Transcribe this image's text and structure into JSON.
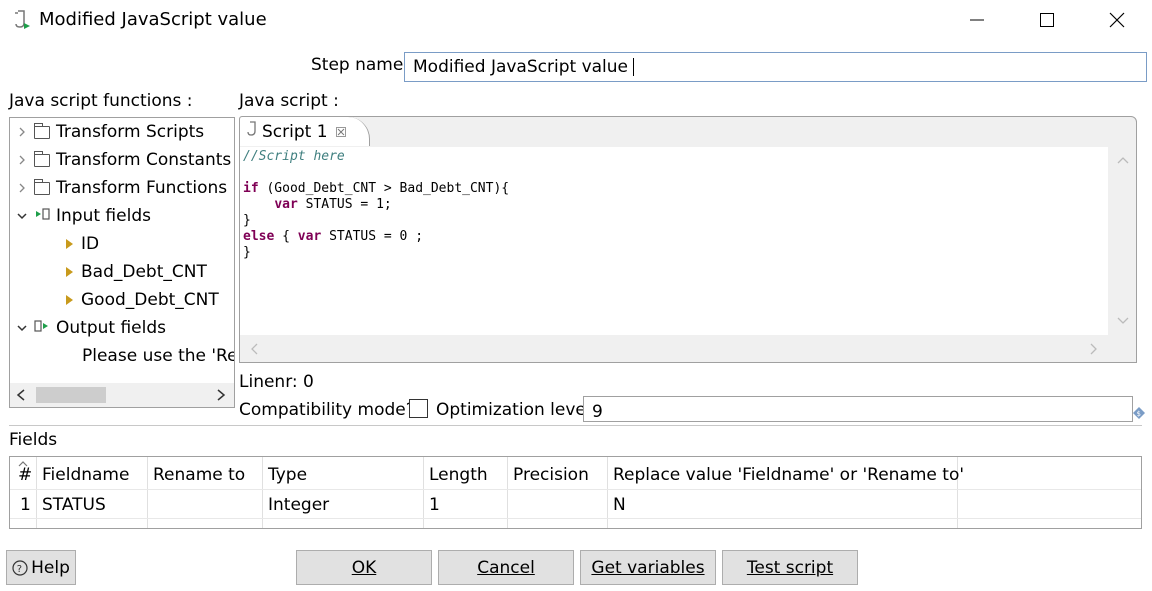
{
  "window": {
    "title": "Modified JavaScript value"
  },
  "step_name": {
    "label": "Step name",
    "value": "Modified JavaScript value"
  },
  "functions_panel": {
    "label": "Java script functions :",
    "items": [
      {
        "label": "Transform Scripts"
      },
      {
        "label": "Transform Constants"
      },
      {
        "label": "Transform Functions"
      },
      {
        "label": "Input fields"
      },
      {
        "label": "ID"
      },
      {
        "label": "Bad_Debt_CNT"
      },
      {
        "label": "Good_Debt_CNT"
      },
      {
        "label": "Output fields"
      },
      {
        "label": "Please use the 'Rep"
      }
    ]
  },
  "script_panel": {
    "label": "Java script :",
    "tab_label": "Script 1",
    "code_lines": [
      "//Script here",
      "",
      "if (Good_Debt_CNT > Bad_Debt_CNT){",
      "    var STATUS = 1;",
      "}",
      "else { var STATUS = 0 ;",
      "}"
    ]
  },
  "status": {
    "linenr": "Linenr: 0",
    "compat_label": "Compatibility mode?",
    "opt_label": "Optimization level",
    "opt_value": "9"
  },
  "fields": {
    "label": "Fields",
    "columns": [
      "#",
      "Fieldname",
      "Rename to",
      "Type",
      "Length",
      "Precision",
      "Replace value 'Fieldname' or 'Rename to'"
    ],
    "rows": [
      {
        "num": "1",
        "fieldname": "STATUS",
        "rename": "",
        "type": "Integer",
        "length": "1",
        "precision": "",
        "replace": "N"
      }
    ]
  },
  "buttons": {
    "help": "Help",
    "ok": "OK",
    "cancel": "Cancel",
    "get_variables": "Get variables",
    "test_script": "Test script"
  },
  "colors": {
    "keyword": "#7f0055",
    "comment": "#3f7f7f",
    "button_bg": "#e1e1e1",
    "input_border": "#7a9cc6"
  }
}
